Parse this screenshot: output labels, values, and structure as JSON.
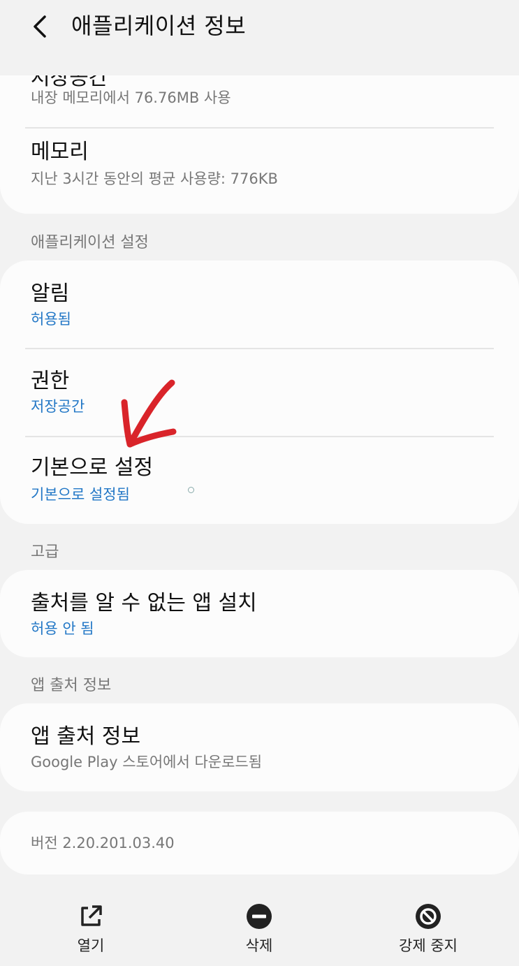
{
  "header": {
    "title": "애플리케이션 정보"
  },
  "storage": {
    "title": "저장공간",
    "subtitle": "내장 메모리에서 76.76MB 사용"
  },
  "memory": {
    "title": "메모리",
    "subtitle": "지난 3시간 동안의 평균 사용량: 776KB"
  },
  "app_settings": {
    "section_label": "애플리케이션 설정",
    "notifications": {
      "title": "알림",
      "subtitle": "허용됨"
    },
    "permissions": {
      "title": "권한",
      "subtitle": "저장공간"
    },
    "set_default": {
      "title": "기본으로 설정",
      "subtitle": "기본으로 설정됨"
    }
  },
  "advanced": {
    "section_label": "고급",
    "unknown_sources": {
      "title": "출처를 알 수 없는 앱 설치",
      "subtitle": "허용 안 됨"
    }
  },
  "app_source": {
    "section_label": "앱 출처 정보",
    "title": "앱 출처 정보",
    "subtitle": "Google Play 스토어에서 다운로드됨"
  },
  "version": {
    "text": "버전 2.20.201.03.40"
  },
  "bottom_bar": {
    "open_label": "열기",
    "uninstall_label": "삭제",
    "force_stop_label": "강제 중지"
  },
  "colors": {
    "background": "#f2f2f2",
    "card": "#fcfcfc",
    "accent_blue": "#2277c6",
    "annotation_red": "#d9242a"
  },
  "icons": {
    "back": "chevron-left-icon",
    "open": "external-link-icon",
    "uninstall": "minus-circle-icon",
    "force_stop": "prohibited-icon"
  }
}
